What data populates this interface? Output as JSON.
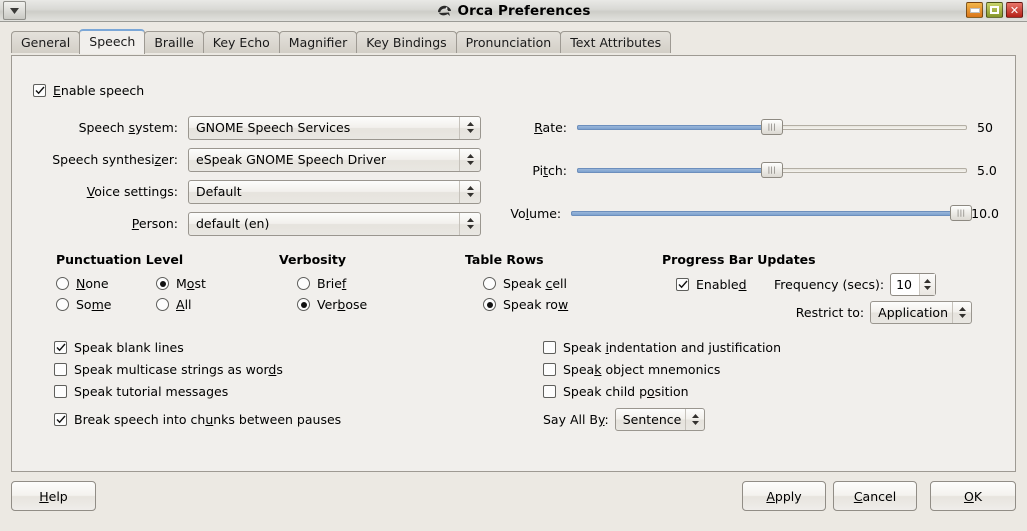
{
  "window": {
    "title": "Orca Preferences",
    "menu_icon": "window-menu-icon",
    "app_icon": "orca-icon",
    "minimize_label": "minimize-icon",
    "maximize_label": "maximize-icon",
    "close_label": "close-icon"
  },
  "tabs": [
    {
      "label": "General",
      "active": false
    },
    {
      "label": "Speech",
      "active": true
    },
    {
      "label": "Braille",
      "active": false
    },
    {
      "label": "Key Echo",
      "active": false
    },
    {
      "label": "Magnifier",
      "active": false
    },
    {
      "label": "Key Bindings",
      "active": false
    },
    {
      "label": "Pronunciation",
      "active": false
    },
    {
      "label": "Text Attributes",
      "active": false
    }
  ],
  "speech": {
    "enable_speech": {
      "label": "Enable speech",
      "checked": true
    },
    "combos": [
      {
        "label": "Speech system:",
        "value": "GNOME Speech Services"
      },
      {
        "label": "Speech synthesizer:",
        "value": "eSpeak GNOME Speech Driver"
      },
      {
        "label": "Voice settings:",
        "value": "Default"
      },
      {
        "label": "Person:",
        "value": "default (en)"
      }
    ],
    "sliders": [
      {
        "label": "Rate:",
        "value": "50",
        "percent": 50
      },
      {
        "label": "Pitch:",
        "value": "5.0",
        "percent": 50
      },
      {
        "label": "Volume:",
        "value": "10.0",
        "percent": 100
      }
    ],
    "punctuation": {
      "title": "Punctuation Level",
      "options": [
        {
          "label": "None",
          "selected": false
        },
        {
          "label": "Most",
          "selected": true
        },
        {
          "label": "Some",
          "selected": false
        },
        {
          "label": "All",
          "selected": false
        }
      ]
    },
    "verbosity": {
      "title": "Verbosity",
      "options": [
        {
          "label": "Brief",
          "selected": false
        },
        {
          "label": "Verbose",
          "selected": true
        }
      ]
    },
    "table_rows": {
      "title": "Table Rows",
      "options": [
        {
          "label": "Speak cell",
          "selected": false
        },
        {
          "label": "Speak row",
          "selected": true
        }
      ]
    },
    "progress_bar": {
      "title": "Progress Bar Updates",
      "enabled": {
        "label": "Enabled",
        "checked": true
      },
      "frequency_label": "Frequency (secs):",
      "frequency_value": "10",
      "restrict_label": "Restrict to:",
      "restrict_value": "Application"
    },
    "checkboxes_left": [
      {
        "label": "Speak blank lines",
        "checked": true
      },
      {
        "label": "Speak multicase strings as words",
        "checked": false
      },
      {
        "label": "Speak tutorial messages",
        "checked": false
      },
      {
        "label": "Break speech into chunks between pauses",
        "checked": true
      }
    ],
    "checkboxes_right": [
      {
        "label": "Speak indentation and justification",
        "checked": false
      },
      {
        "label": "Speak object mnemonics",
        "checked": false
      },
      {
        "label": "Speak child position",
        "checked": false
      }
    ],
    "say_all_by": {
      "label": "Say All By:",
      "value": "Sentence"
    }
  },
  "buttons": {
    "help": "Help",
    "apply": "Apply",
    "cancel": "Cancel",
    "ok": "OK"
  },
  "colors": {
    "accent": "#7ea2cf",
    "panel": "#f1efec",
    "window": "#ece9e3"
  }
}
